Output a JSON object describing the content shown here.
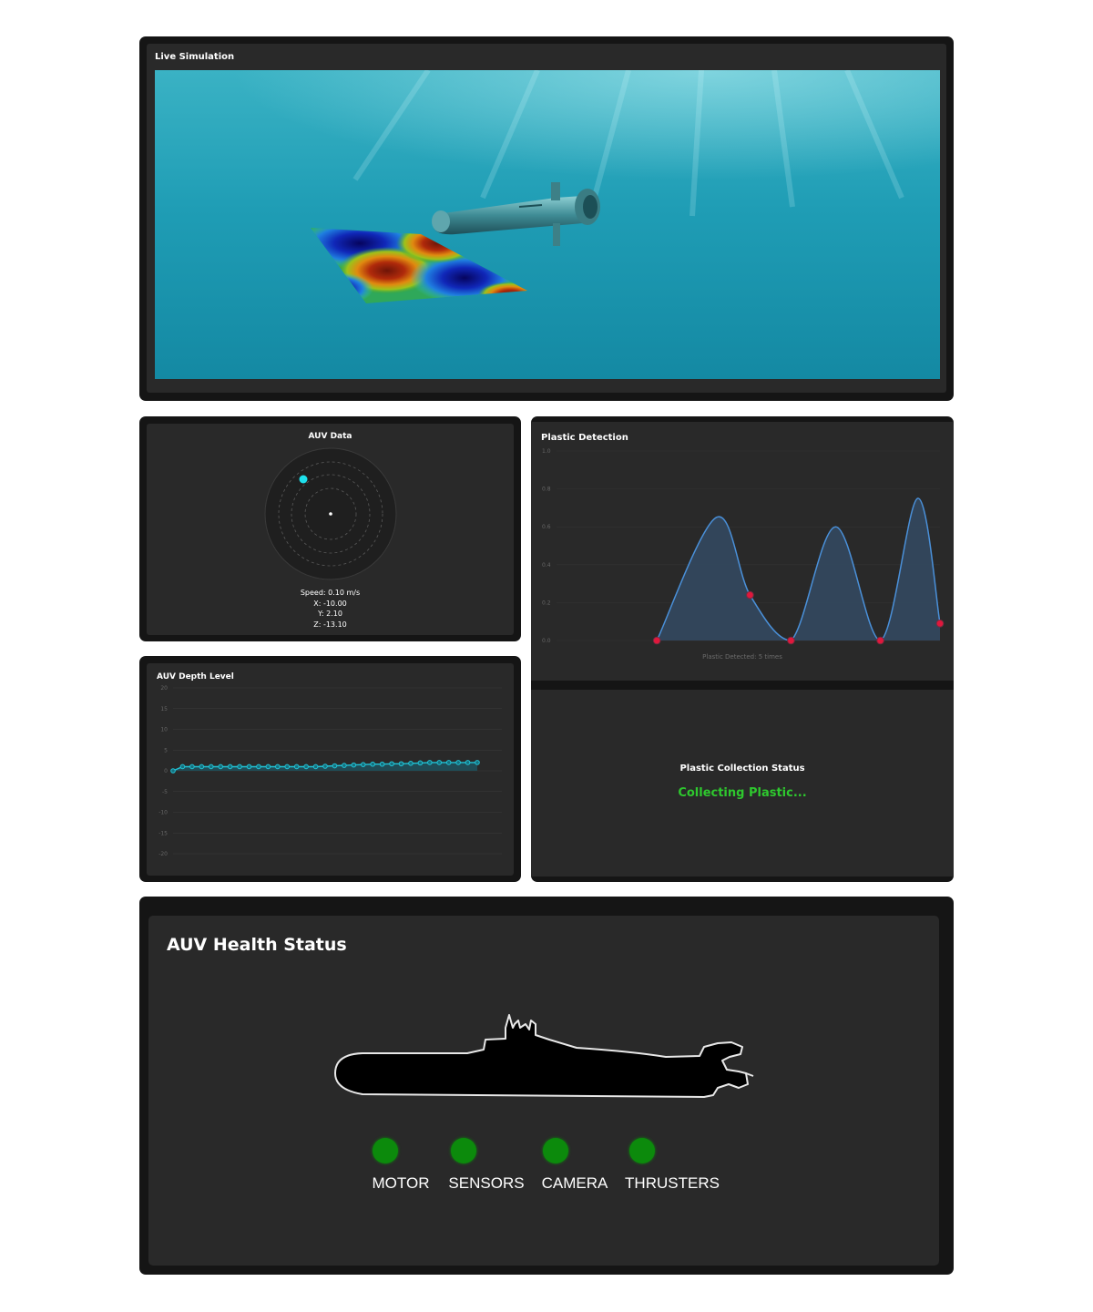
{
  "live_simulation": {
    "title": "Live Simulation"
  },
  "auv_data": {
    "title": "AUV Data",
    "speed": "Speed: 0.10 m/s",
    "x": "X: -10.00",
    "y": "Y: 2.10",
    "z": "Z: -13.10"
  },
  "depth": {
    "title": "AUV Depth Level",
    "chart_data": {
      "type": "line",
      "title": "AUV Depth Level",
      "y_ticks": [
        "20",
        "15",
        "10",
        "5",
        "0",
        "-5",
        "-10",
        "-15",
        "-20"
      ],
      "ylim": [
        -20,
        20
      ],
      "grid": true,
      "values": [
        0,
        1,
        1,
        1,
        1,
        1,
        1,
        1,
        1,
        1,
        1,
        1,
        1,
        1,
        1,
        1,
        1.1,
        1.2,
        1.3,
        1.4,
        1.5,
        1.6,
        1.6,
        1.7,
        1.7,
        1.8,
        1.9,
        2.0,
        2.0,
        2.0,
        2.0,
        2.0,
        2.0
      ],
      "color": "#21c3d6"
    }
  },
  "plastic_detection": {
    "title": "Plastic Detection",
    "caption": "Plastic Detected: 5 times",
    "chart_data": {
      "type": "area",
      "title": "Plastic Detection",
      "y_ticks": [
        "1.0",
        "0.8",
        "0.6",
        "0.4",
        "0.2",
        "0.0"
      ],
      "ylim": [
        0,
        1.0
      ],
      "grid": true,
      "points": [
        {
          "x": 0.24,
          "y": 0.0
        },
        {
          "x": 0.4,
          "y": 0.65
        },
        {
          "x": 0.49,
          "y": 0.24
        },
        {
          "x": 0.6,
          "y": 0.0
        },
        {
          "x": 0.72,
          "y": 0.6
        },
        {
          "x": 0.84,
          "y": 0.0
        },
        {
          "x": 0.94,
          "y": 0.75
        },
        {
          "x": 1.0,
          "y": 0.09
        }
      ],
      "detections": [
        {
          "x": 0.24,
          "y": 0.0
        },
        {
          "x": 0.49,
          "y": 0.24
        },
        {
          "x": 0.6,
          "y": 0.0
        },
        {
          "x": 0.84,
          "y": 0.0
        },
        {
          "x": 1.0,
          "y": 0.09
        }
      ],
      "line_color": "#4a90d9",
      "fill_color": "#344a63",
      "marker_color": "#e0183c"
    }
  },
  "collection": {
    "title": "Plastic Collection Status",
    "status": "Collecting Plastic...",
    "status_color": "#2ec82e"
  },
  "health": {
    "title": "AUV Health Status",
    "indicators": [
      {
        "label": "MOTOR",
        "status": "ok",
        "color": "#0c8a0c"
      },
      {
        "label": "SENSORS",
        "status": "ok",
        "color": "#0c8a0c"
      },
      {
        "label": "CAMERA",
        "status": "ok",
        "color": "#0c8a0c"
      },
      {
        "label": "THRUSTERS",
        "status": "ok",
        "color": "#0c8a0c"
      }
    ]
  }
}
